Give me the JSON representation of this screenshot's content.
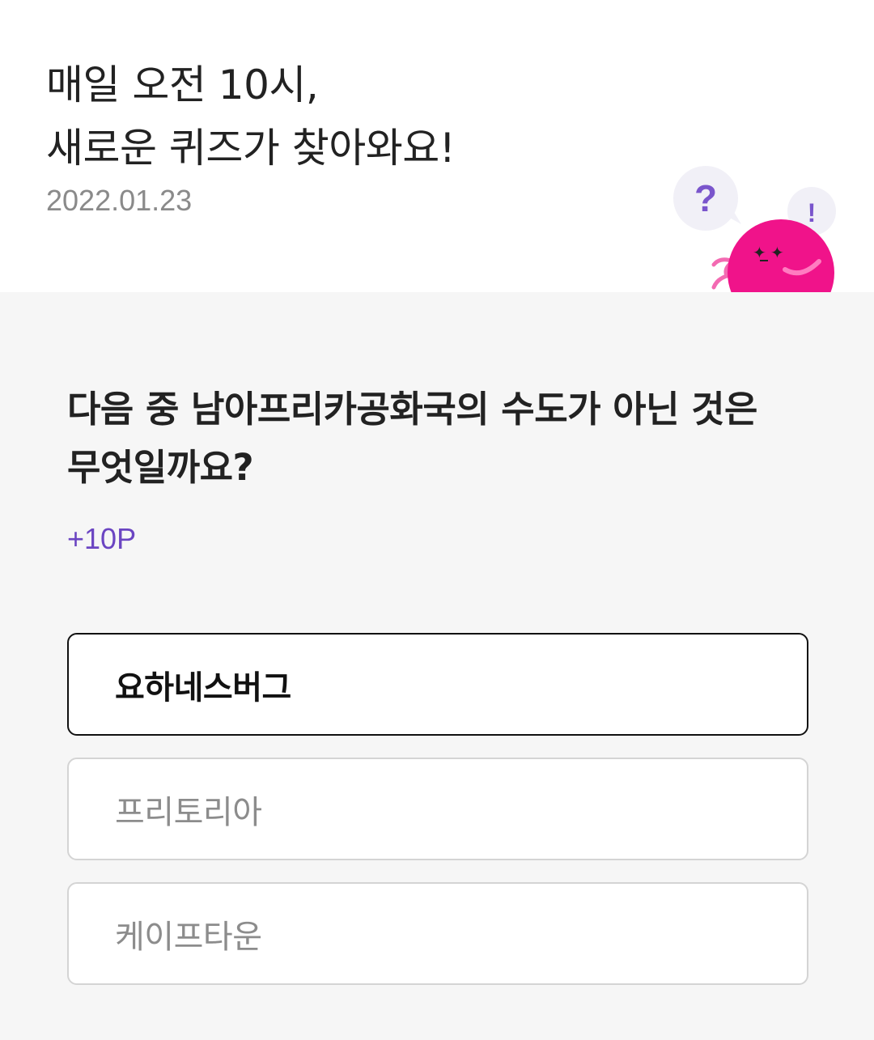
{
  "header": {
    "title_line1": "매일 오전 10시,",
    "title_line2": "새로운 퀴즈가 찾아와요!",
    "date": "2022.01.23"
  },
  "mascot": {
    "icon": "quiz-mascot-icon",
    "bubble_question": "?",
    "bubble_exclaim": "!",
    "colors": {
      "body": "#f0138a",
      "bubble": "#f1f0f7",
      "mark": "#7a55cc"
    }
  },
  "quiz": {
    "question_line1": "다음 중 남아프리카공화국의 수도가 아닌 것은",
    "question_line2": "무엇일까요?",
    "points": "+10P",
    "options": [
      {
        "label": "요하네스버그",
        "selected": true
      },
      {
        "label": "프리토리아",
        "selected": false
      },
      {
        "label": "케이프타운",
        "selected": false
      }
    ]
  },
  "colors": {
    "accent": "#6b45c2",
    "background": "#f6f6f6",
    "selected_border": "#111111",
    "border": "#d4d4d4"
  }
}
